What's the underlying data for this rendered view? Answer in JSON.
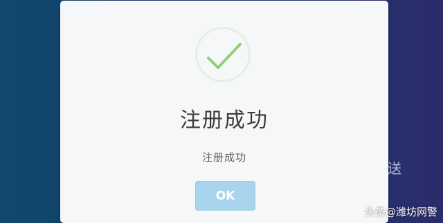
{
  "background": {
    "partial_text": "送"
  },
  "dialog": {
    "icon": "check-icon",
    "title": "注册成功",
    "message": "注册成功",
    "ok_label": "OK"
  },
  "watermark": {
    "text": "头条@潍坊网警"
  },
  "colors": {
    "backdrop_left": "#11486b",
    "backdrop_right": "#2b2c6c",
    "check": "#8fcf7a",
    "ok_button": "#a8d4ee"
  }
}
